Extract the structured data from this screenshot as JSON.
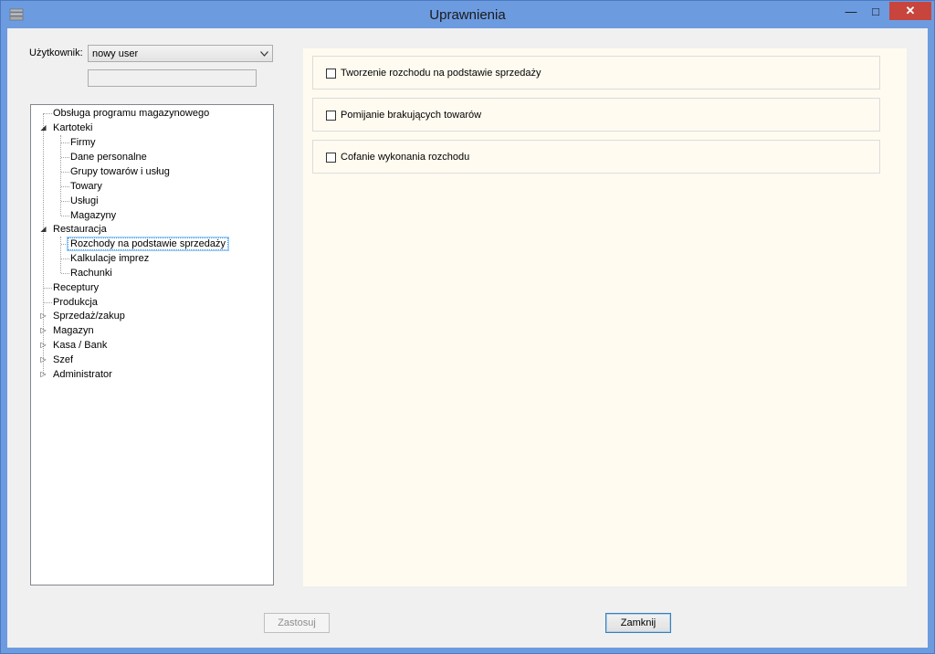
{
  "window": {
    "title": "Uprawnienia",
    "close_symbol": "✕",
    "min_symbol": "—",
    "max_symbol": "□"
  },
  "user": {
    "label": "Użytkownik:",
    "selected": "nowy user",
    "extra_field": ""
  },
  "tree": {
    "nodes": [
      {
        "label": "Obsługa programu magazynowego"
      },
      {
        "label": "Kartoteki"
      },
      {
        "label": "Firmy"
      },
      {
        "label": "Dane personalne"
      },
      {
        "label": "Grupy towarów i usług"
      },
      {
        "label": "Towary"
      },
      {
        "label": "Usługi"
      },
      {
        "label": "Magazyny"
      },
      {
        "label": "Restauracja"
      },
      {
        "label": "Rozchody na podstawie sprzedaży"
      },
      {
        "label": "Kalkulacje imprez"
      },
      {
        "label": "Rachunki"
      },
      {
        "label": "Receptury"
      },
      {
        "label": "Produkcja"
      },
      {
        "label": "Sprzedaż/zakup"
      },
      {
        "label": "Magazyn"
      },
      {
        "label": "Kasa / Bank"
      },
      {
        "label": "Szef"
      },
      {
        "label": "Administrator"
      }
    ],
    "expanded_glyph": "◢",
    "collapsed_glyph": "▷"
  },
  "permissions": [
    {
      "label": "Tworzenie rozchodu na podstawie sprzedaży",
      "checked": false
    },
    {
      "label": "Pomijanie brakujących towarów",
      "checked": false
    },
    {
      "label": "Cofanie wykonania rozchodu",
      "checked": false
    }
  ],
  "buttons": {
    "apply": "Zastosuj",
    "close": "Zamknij"
  },
  "colors": {
    "accent": "#3399ff",
    "panel_bg": "#fffbf0",
    "close_btn": "#c7453c"
  }
}
